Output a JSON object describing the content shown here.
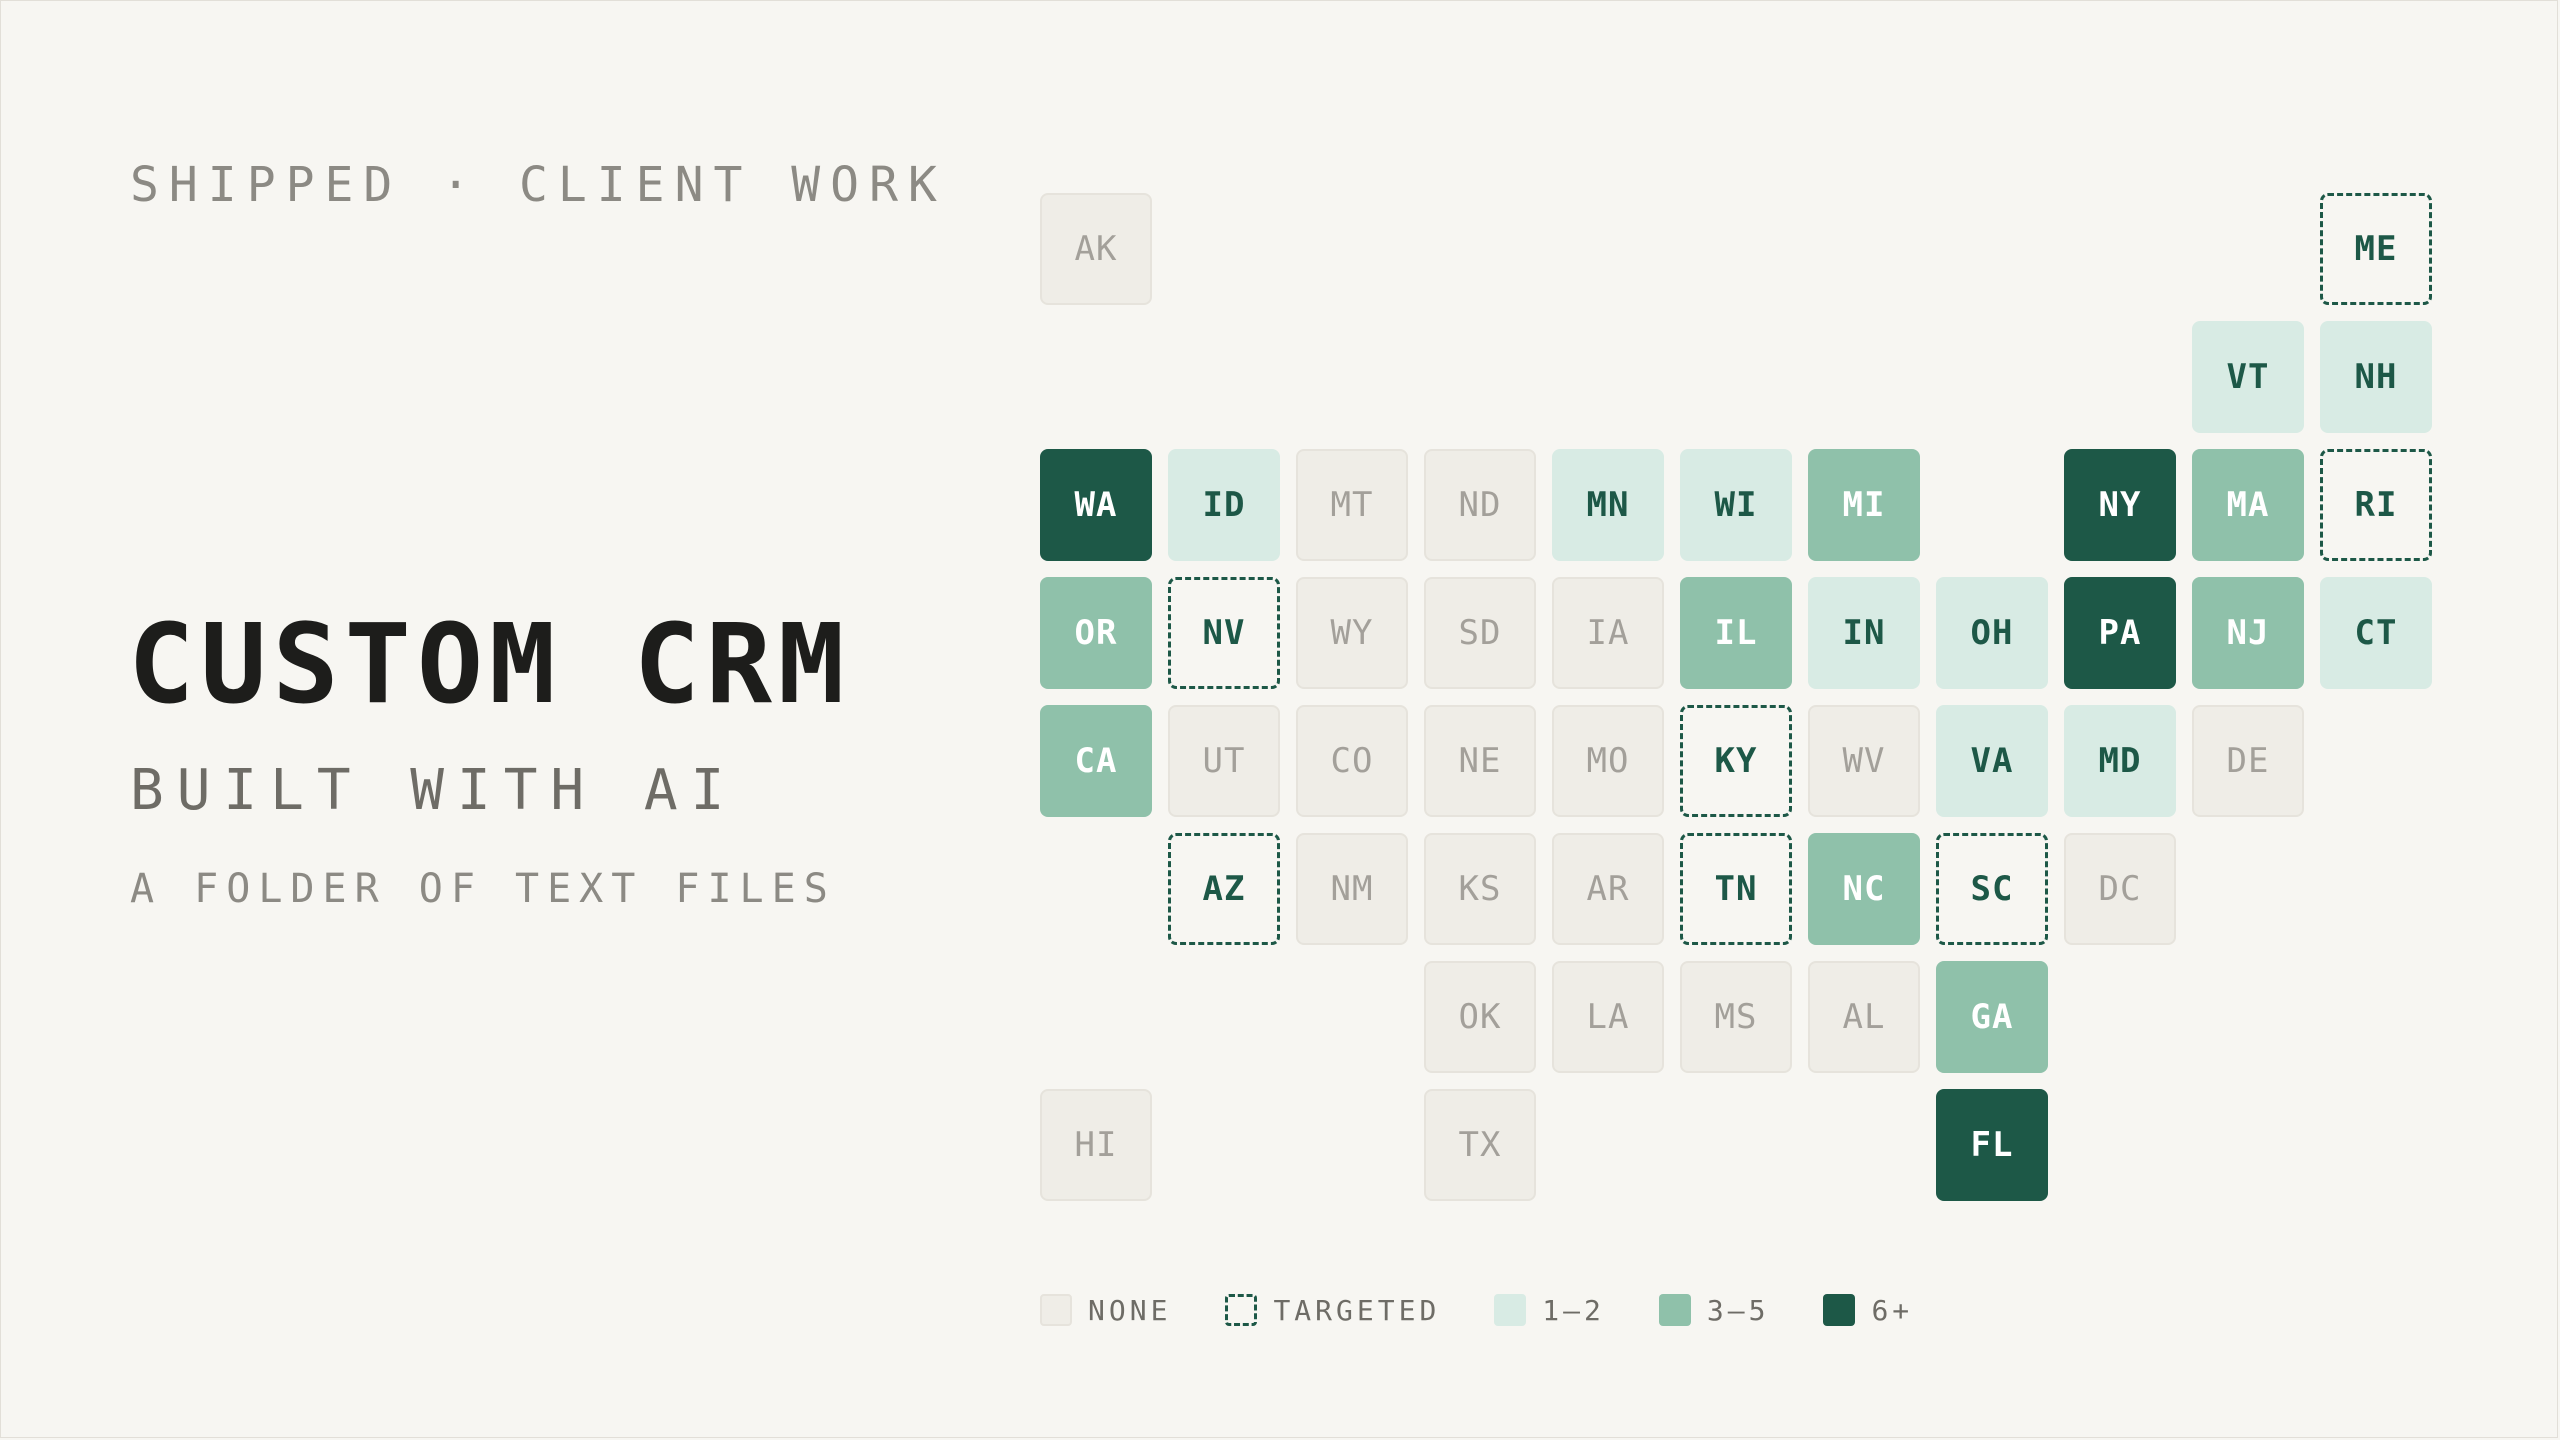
{
  "header": {
    "kicker": "SHIPPED · CLIENT WORK",
    "title": "CUSTOM CRM",
    "subtitle": "BUILT WITH AI",
    "tagline": "A FOLDER OF TEXT FILES"
  },
  "colors": {
    "background": "#f7f6f2",
    "none": "#efede7",
    "targeted_border": "#1d5847",
    "low": "#d8ebe4",
    "mid": "#8fc1aa",
    "high": "#1d5847"
  },
  "legend": [
    {
      "key": "none",
      "label": "NONE"
    },
    {
      "key": "targeted",
      "label": "TARGETED"
    },
    {
      "key": "low",
      "label": "1–2"
    },
    {
      "key": "mid",
      "label": "3–5"
    },
    {
      "key": "high",
      "label": "6+"
    }
  ],
  "states": [
    {
      "code": "AK",
      "level": "none",
      "row": 0,
      "col": 0
    },
    {
      "code": "ME",
      "level": "targeted",
      "row": 0,
      "col": 10
    },
    {
      "code": "VT",
      "level": "low",
      "row": 1,
      "col": 9
    },
    {
      "code": "NH",
      "level": "low",
      "row": 1,
      "col": 10
    },
    {
      "code": "WA",
      "level": "high",
      "row": 2,
      "col": 0
    },
    {
      "code": "ID",
      "level": "low",
      "row": 2,
      "col": 1
    },
    {
      "code": "MT",
      "level": "none",
      "row": 2,
      "col": 2
    },
    {
      "code": "ND",
      "level": "none",
      "row": 2,
      "col": 3
    },
    {
      "code": "MN",
      "level": "low",
      "row": 2,
      "col": 4
    },
    {
      "code": "WI",
      "level": "low",
      "row": 2,
      "col": 5
    },
    {
      "code": "MI",
      "level": "mid",
      "row": 2,
      "col": 6
    },
    {
      "code": "NY",
      "level": "high",
      "row": 2,
      "col": 8
    },
    {
      "code": "MA",
      "level": "mid",
      "row": 2,
      "col": 9
    },
    {
      "code": "RI",
      "level": "targeted",
      "row": 2,
      "col": 10
    },
    {
      "code": "OR",
      "level": "mid",
      "row": 3,
      "col": 0
    },
    {
      "code": "NV",
      "level": "targeted",
      "row": 3,
      "col": 1
    },
    {
      "code": "WY",
      "level": "none",
      "row": 3,
      "col": 2
    },
    {
      "code": "SD",
      "level": "none",
      "row": 3,
      "col": 3
    },
    {
      "code": "IA",
      "level": "none",
      "row": 3,
      "col": 4
    },
    {
      "code": "IL",
      "level": "mid",
      "row": 3,
      "col": 5
    },
    {
      "code": "IN",
      "level": "low",
      "row": 3,
      "col": 6
    },
    {
      "code": "OH",
      "level": "low",
      "row": 3,
      "col": 7
    },
    {
      "code": "PA",
      "level": "high",
      "row": 3,
      "col": 8
    },
    {
      "code": "NJ",
      "level": "mid",
      "row": 3,
      "col": 9
    },
    {
      "code": "CT",
      "level": "low",
      "row": 3,
      "col": 10
    },
    {
      "code": "CA",
      "level": "mid",
      "row": 4,
      "col": 0
    },
    {
      "code": "UT",
      "level": "none",
      "row": 4,
      "col": 1
    },
    {
      "code": "CO",
      "level": "none",
      "row": 4,
      "col": 2
    },
    {
      "code": "NE",
      "level": "none",
      "row": 4,
      "col": 3
    },
    {
      "code": "MO",
      "level": "none",
      "row": 4,
      "col": 4
    },
    {
      "code": "KY",
      "level": "targeted",
      "row": 4,
      "col": 5
    },
    {
      "code": "WV",
      "level": "none",
      "row": 4,
      "col": 6
    },
    {
      "code": "VA",
      "level": "low",
      "row": 4,
      "col": 7
    },
    {
      "code": "MD",
      "level": "low",
      "row": 4,
      "col": 8
    },
    {
      "code": "DE",
      "level": "none",
      "row": 4,
      "col": 9
    },
    {
      "code": "AZ",
      "level": "targeted",
      "row": 5,
      "col": 1
    },
    {
      "code": "NM",
      "level": "none",
      "row": 5,
      "col": 2
    },
    {
      "code": "KS",
      "level": "none",
      "row": 5,
      "col": 3
    },
    {
      "code": "AR",
      "level": "none",
      "row": 5,
      "col": 4
    },
    {
      "code": "TN",
      "level": "targeted",
      "row": 5,
      "col": 5
    },
    {
      "code": "NC",
      "level": "mid",
      "row": 5,
      "col": 6
    },
    {
      "code": "SC",
      "level": "targeted",
      "row": 5,
      "col": 7
    },
    {
      "code": "DC",
      "level": "none",
      "row": 5,
      "col": 8
    },
    {
      "code": "OK",
      "level": "none",
      "row": 6,
      "col": 3
    },
    {
      "code": "LA",
      "level": "none",
      "row": 6,
      "col": 4
    },
    {
      "code": "MS",
      "level": "none",
      "row": 6,
      "col": 5
    },
    {
      "code": "AL",
      "level": "none",
      "row": 6,
      "col": 6
    },
    {
      "code": "GA",
      "level": "mid",
      "row": 6,
      "col": 7
    },
    {
      "code": "HI",
      "level": "none",
      "row": 7,
      "col": 0
    },
    {
      "code": "TX",
      "level": "none",
      "row": 7,
      "col": 3
    },
    {
      "code": "FL",
      "level": "high",
      "row": 7,
      "col": 7
    }
  ]
}
